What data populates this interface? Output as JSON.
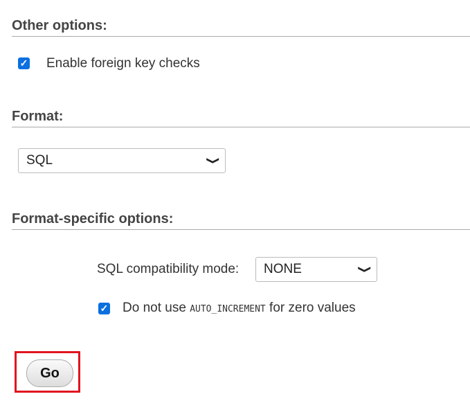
{
  "other": {
    "heading": "Other options:",
    "fk_label": "Enable foreign key checks",
    "fk_checked": true
  },
  "format": {
    "heading": "Format:",
    "value": "SQL"
  },
  "specific": {
    "heading": "Format-specific options:",
    "compat_label": "SQL compatibility mode:",
    "compat_value": "NONE",
    "ai_prefix": "Do not use",
    "ai_code": "AUTO_INCREMENT",
    "ai_suffix": "for zero values",
    "ai_checked": true
  },
  "go_label": "Go"
}
